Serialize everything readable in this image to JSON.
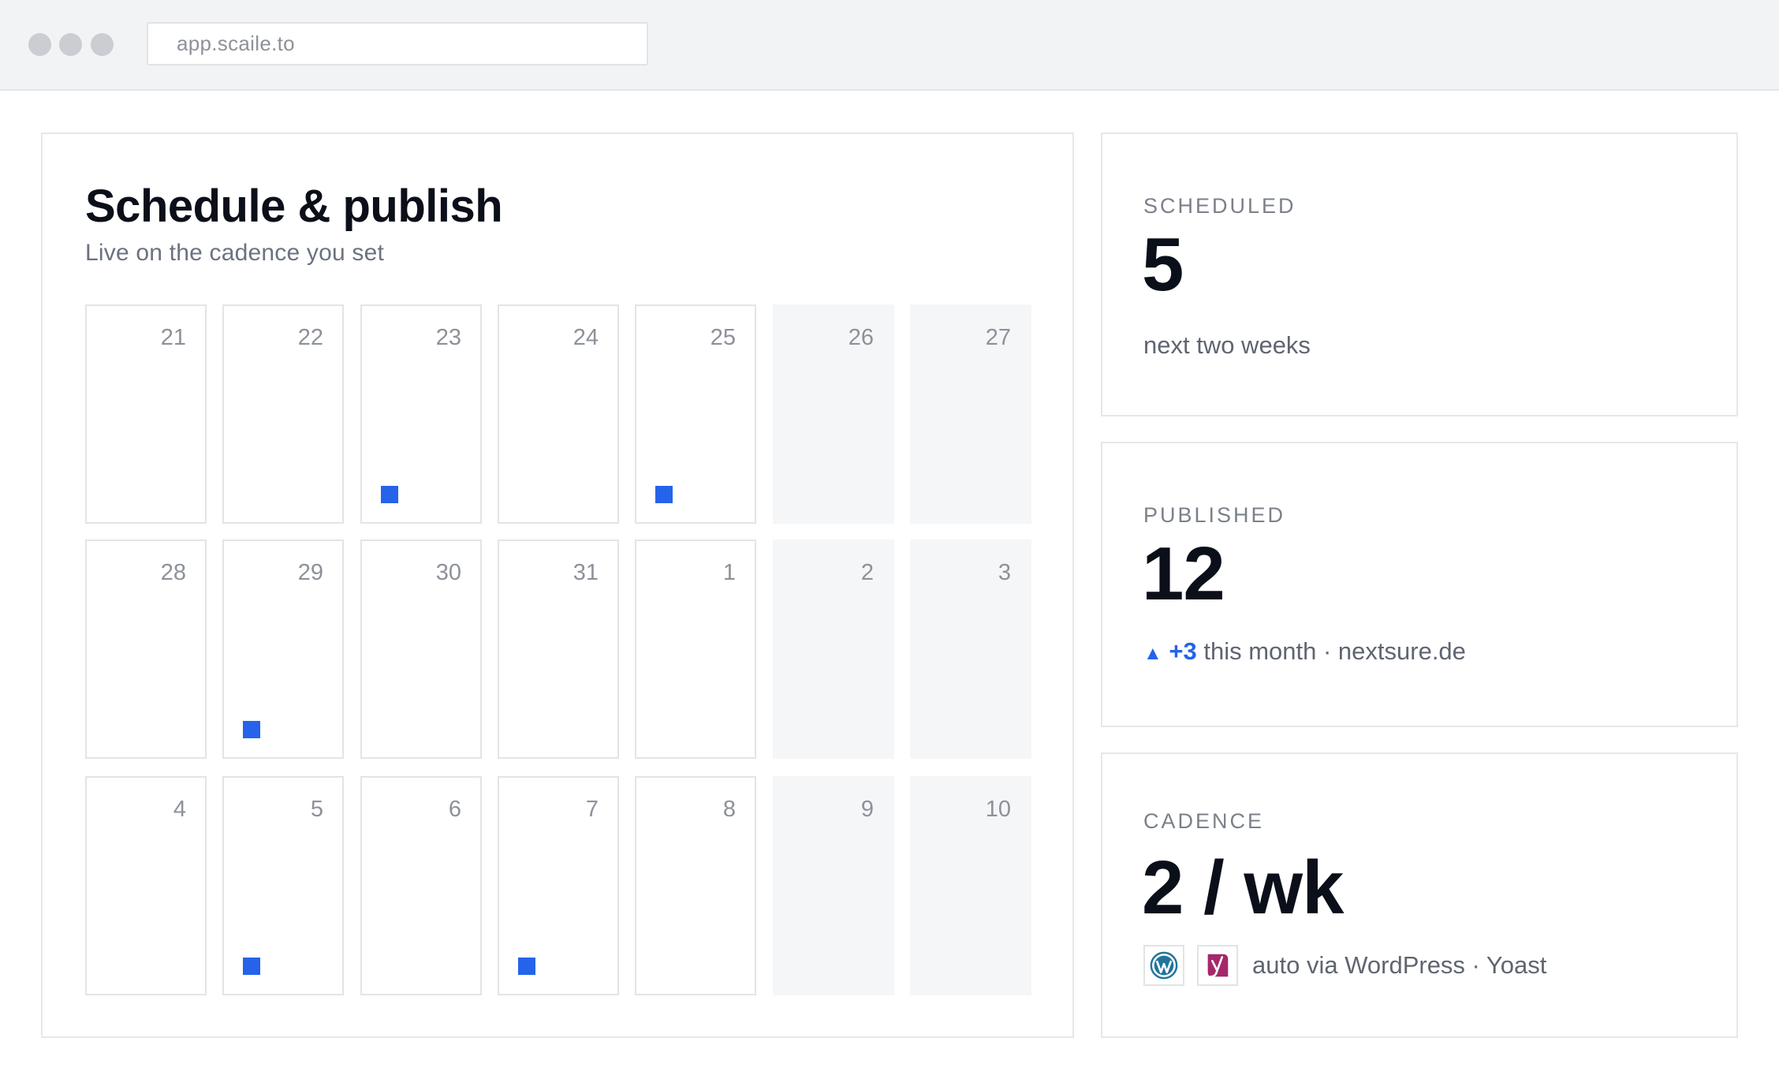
{
  "browser": {
    "url": "app.scaile.to"
  },
  "schedule": {
    "title": "Schedule & publish",
    "subtitle": "Live on the cadence you set",
    "weeks": [
      [
        {
          "day": "21",
          "weekend": false,
          "scheduled": false
        },
        {
          "day": "22",
          "weekend": false,
          "scheduled": false
        },
        {
          "day": "23",
          "weekend": false,
          "scheduled": true
        },
        {
          "day": "24",
          "weekend": false,
          "scheduled": false
        },
        {
          "day": "25",
          "weekend": false,
          "scheduled": true
        },
        {
          "day": "26",
          "weekend": true,
          "scheduled": false
        },
        {
          "day": "27",
          "weekend": true,
          "scheduled": false
        }
      ],
      [
        {
          "day": "28",
          "weekend": false,
          "scheduled": false
        },
        {
          "day": "29",
          "weekend": false,
          "scheduled": true
        },
        {
          "day": "30",
          "weekend": false,
          "scheduled": false
        },
        {
          "day": "31",
          "weekend": false,
          "scheduled": false
        },
        {
          "day": "1",
          "weekend": false,
          "scheduled": false
        },
        {
          "day": "2",
          "weekend": true,
          "scheduled": false
        },
        {
          "day": "3",
          "weekend": true,
          "scheduled": false
        }
      ],
      [
        {
          "day": "4",
          "weekend": false,
          "scheduled": false
        },
        {
          "day": "5",
          "weekend": false,
          "scheduled": true
        },
        {
          "day": "6",
          "weekend": false,
          "scheduled": false
        },
        {
          "day": "7",
          "weekend": false,
          "scheduled": true
        },
        {
          "day": "8",
          "weekend": false,
          "scheduled": false
        },
        {
          "day": "9",
          "weekend": true,
          "scheduled": false
        },
        {
          "day": "10",
          "weekend": true,
          "scheduled": false
        }
      ]
    ]
  },
  "stats": {
    "scheduled": {
      "label": "SCHEDULED",
      "value": "5",
      "note": "next two weeks"
    },
    "published": {
      "label": "PUBLISHED",
      "value": "12",
      "delta": "+3",
      "note": " this month · nextsure.de"
    },
    "cadence": {
      "label": "CADENCE",
      "value": "2 / wk",
      "note": "auto via WordPress · Yoast",
      "icons": [
        "wordpress-icon",
        "yoast-icon"
      ]
    }
  },
  "colors": {
    "accent": "#2563eb",
    "yoast": "#a4286a",
    "wordpress": "#21759b"
  }
}
